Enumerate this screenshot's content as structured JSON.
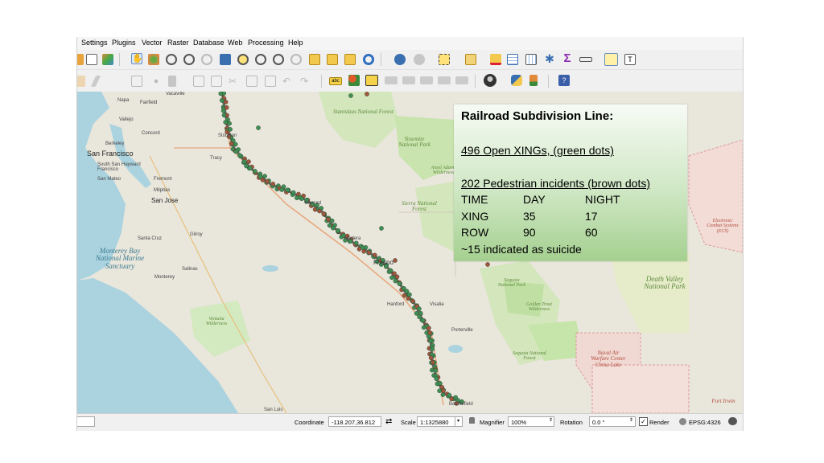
{
  "menu": [
    "Settings",
    "Plugins",
    "Vector",
    "Raster",
    "Database",
    "Web",
    "Processing",
    "Help"
  ],
  "colors": {
    "xing_dot": "#3f8f55",
    "incident_dot": "#a0563c",
    "route": "#6d6a63",
    "panel_top": "#f7fbf5",
    "panel_bottom": "#a5d090"
  },
  "icons": {
    "toolbar1": [
      "open-project-icon",
      "layer-properties-icon",
      "style-icon",
      "pan-hand-icon",
      "pan-to-selection-icon",
      "zoom-in-icon",
      "zoom-out-icon",
      "zoom-full-icon",
      "zoom-selection-icon",
      "zoom-layer-icon",
      "zoom-last-icon",
      "zoom-next-icon",
      "new-bookmark-icon",
      "show-bookmarks-icon",
      "spatial-bookmark-icon",
      "refresh-icon",
      "identify-icon",
      "run-action-icon",
      "select-features-icon",
      "select-by-value-icon",
      "deselect-icon",
      "attribute-table-icon",
      "field-calculator-icon",
      "processing-toolbox-icon",
      "statistics-sigma-icon",
      "measure-icon",
      "map-tips-icon",
      "text-annotation-icon"
    ],
    "toolbar2": [
      "digitize-pencil-icon",
      "edit-pencil-icon",
      "save-edits-icon",
      "add-feature-icon",
      "vertex-tool-icon",
      "attribute-edit-icon",
      "delete-selected-icon",
      "cut-features-icon",
      "copy-features-icon",
      "paste-features-icon",
      "undo-icon",
      "redo-icon",
      "label-abc-icon",
      "label-pin-icon",
      "label-highlight-icon",
      "label-move-icon",
      "label-rotate-icon",
      "label-change-icon",
      "label-show-icon",
      "label-toggle-icon",
      "osm-plugin-icon",
      "python-console-icon",
      "gps-tool-icon",
      "help-book-icon"
    ]
  },
  "map": {
    "labels": {
      "stanislaus": "Stanislaus National Forest",
      "yosemite": "Yosemite National Park",
      "ansel_adams": "Ansel Adams Wilderness",
      "sierra": "Sierra National Forest",
      "monterey_bay": "Monterey Bay National Marine Sanctuary",
      "death_valley": "Death Valley National Park",
      "sequoia_park": "Sequoia National Park",
      "sequoia_forest": "Sequoia National Forest",
      "golden_trout": "Golden Trout Wilderness",
      "ventana": "Ventana Wilderness",
      "naval": "Naval Air Warfare Center China Lake",
      "fort_irwin": "Fort Irwin",
      "electronic": "Electronic Combat Systems (ECS)"
    },
    "cities": {
      "napa": "Napa",
      "fairfield": "Fairfield",
      "vacaville": "Vacaville",
      "vallejo": "Vallejo",
      "concord": "Concord",
      "berkeley": "Berkeley",
      "san_francisco": "San Francisco",
      "south_sf": "South San Francisco",
      "hayward": "Hayward",
      "san_mateo": "San Mateo",
      "fremont": "Fremont",
      "milpitas": "Milpitas",
      "san_jose": "San Jose",
      "gilroy": "Gilroy",
      "santa_cruz": "Santa Cruz",
      "salinas": "Salinas",
      "monterey": "Monterey",
      "stockton": "Stockton",
      "tracy": "Tracy",
      "merced": "Merced",
      "madera": "Madera",
      "fresno": "Fresno",
      "hanford": "Hanford",
      "visalia": "Visalia",
      "porterville": "Porterville",
      "bakersfield": "Bakersfield",
      "san_luis": "San Luis"
    }
  },
  "info_panel": {
    "title": "Railroad Subdivision Line:",
    "xings": "496 Open XINGs, (green dots)",
    "incidents": "202 Pedestrian incidents (brown dots)",
    "table": {
      "headers": [
        "TIME",
        "DAY",
        "NIGHT"
      ],
      "rows": [
        [
          "XING",
          "35",
          "17"
        ],
        [
          "ROW",
          "90",
          "60"
        ]
      ]
    },
    "note": "~15 indicated as suicide"
  },
  "status": {
    "coordinate_label": "Coordinate",
    "coordinate_value": "-118.207,36.812",
    "scale_label": "Scale",
    "scale_value": "1:1325880",
    "magnifier_label": "Magnifier",
    "magnifier_value": "100%",
    "rotation_label": "Rotation",
    "rotation_value": "0.0 °",
    "render_label": "Render",
    "render_checked": true,
    "crs_label": "EPSG:4326"
  }
}
